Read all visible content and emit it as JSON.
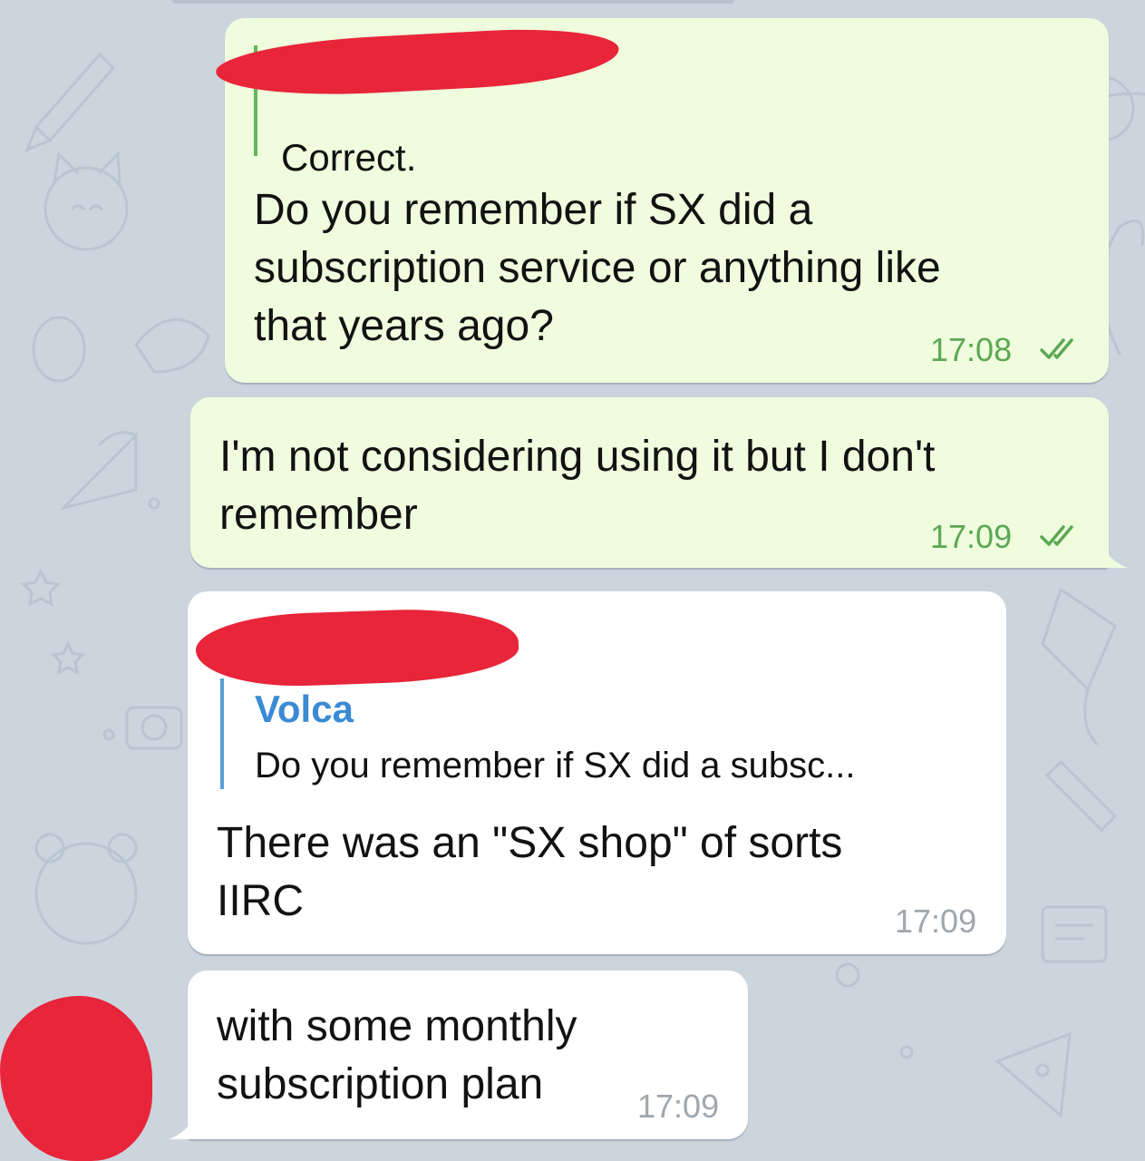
{
  "chat": {
    "messages": [
      {
        "direction": "outgoing",
        "reply_preview": {
          "text": "Correct."
        },
        "text": "Do you remember if SX did a\nsubscription service or anything like\nthat years ago?",
        "time": "17:08",
        "status": "read"
      },
      {
        "direction": "outgoing",
        "text": "I'm not considering using it but I don't\nremember",
        "time": "17:09",
        "status": "read"
      },
      {
        "direction": "incoming",
        "reply_preview": {
          "name": "Volca",
          "text": "Do you remember if SX did a subsc..."
        },
        "text": "There was an \"SX shop\" of sorts\nIIRC",
        "time": "17:09"
      },
      {
        "direction": "incoming",
        "text": "with some monthly\nsubscription plan",
        "time": "17:09"
      }
    ]
  },
  "colors": {
    "background": "#ccd5dd",
    "outgoing_bubble": "#effdde",
    "incoming_bubble": "#ffffff",
    "outgoing_time": "#5ca853",
    "incoming_time": "#a0a7ad",
    "reply_accent_outgoing": "#5fb85a",
    "reply_accent_incoming": "#5b9fd6",
    "redaction": "#e8253a"
  }
}
